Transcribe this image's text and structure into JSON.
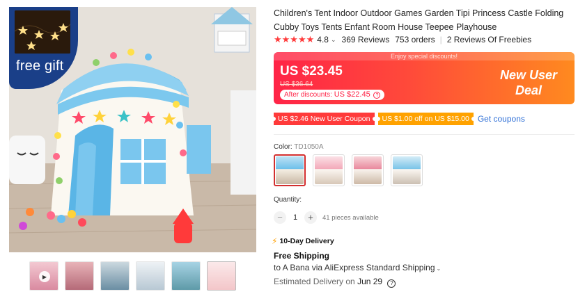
{
  "gallery": {
    "badge_text": "free gift",
    "thumbnail_count": 6,
    "active_thumbnail": 6
  },
  "product": {
    "title": "Children's Tent Indoor Outdoor Games Garden Tipi Princess Castle Folding Cubby Toys Tents Enfant Room House Teepee Playhouse",
    "stars": "★★★★★",
    "rating": "4.8",
    "reviews": "369 Reviews",
    "orders": "753 orders",
    "freebies": "2 Reviews Of Freebies"
  },
  "price": {
    "promo_strip": "Enjoy special discounts!",
    "current": "US $23.45",
    "original": "US $36.64",
    "after_label": "After discounts:",
    "after_value": "US $22.45",
    "deal_line1": "New User",
    "deal_line2": "Deal"
  },
  "coupons": {
    "coupon1": "US $2.46 New User Coupon",
    "coupon2": "US $1.00 off on US $15.00",
    "get_link": "Get coupons"
  },
  "variant": {
    "label": "Color:",
    "selected_code": "TD1050A",
    "swatch_count": 4
  },
  "quantity": {
    "label": "Quantity:",
    "minus": "−",
    "value": "1",
    "plus": "+",
    "available": "41 pieces available"
  },
  "shipping": {
    "badge": "10-Day Delivery",
    "title": "Free Shipping",
    "route": "to A Bana via AliExpress Standard Shipping",
    "eta_label": "Estimated Delivery on",
    "eta_date": "Jun 29"
  },
  "colors": {
    "accent_red": "#ff2447",
    "accent_orange": "#ff8a1f",
    "link_blue": "#2e6fd6",
    "star_red": "#ff3b3b"
  }
}
